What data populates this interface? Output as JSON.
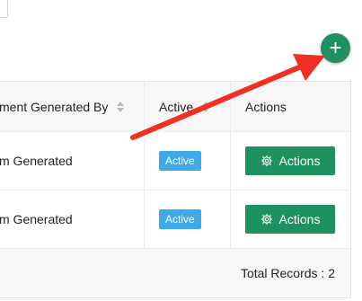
{
  "table": {
    "headers": {
      "generated_by": "ment Generated By",
      "active": "Active",
      "actions": "Actions"
    },
    "rows": [
      {
        "generated_by": "m Generated",
        "status": "Active",
        "action_label": "Actions"
      },
      {
        "generated_by": "m Generated",
        "status": "Active",
        "action_label": "Actions"
      }
    ],
    "footer": "Total Records : 2"
  },
  "add_button": {
    "label": "+"
  },
  "colors": {
    "primary": "#1f9060",
    "badge": "#3fa9e8",
    "arrow": "#ee3124"
  },
  "icons": {
    "add": "plus-icon",
    "actions": "gear-icon",
    "sort": "sort-icon"
  }
}
